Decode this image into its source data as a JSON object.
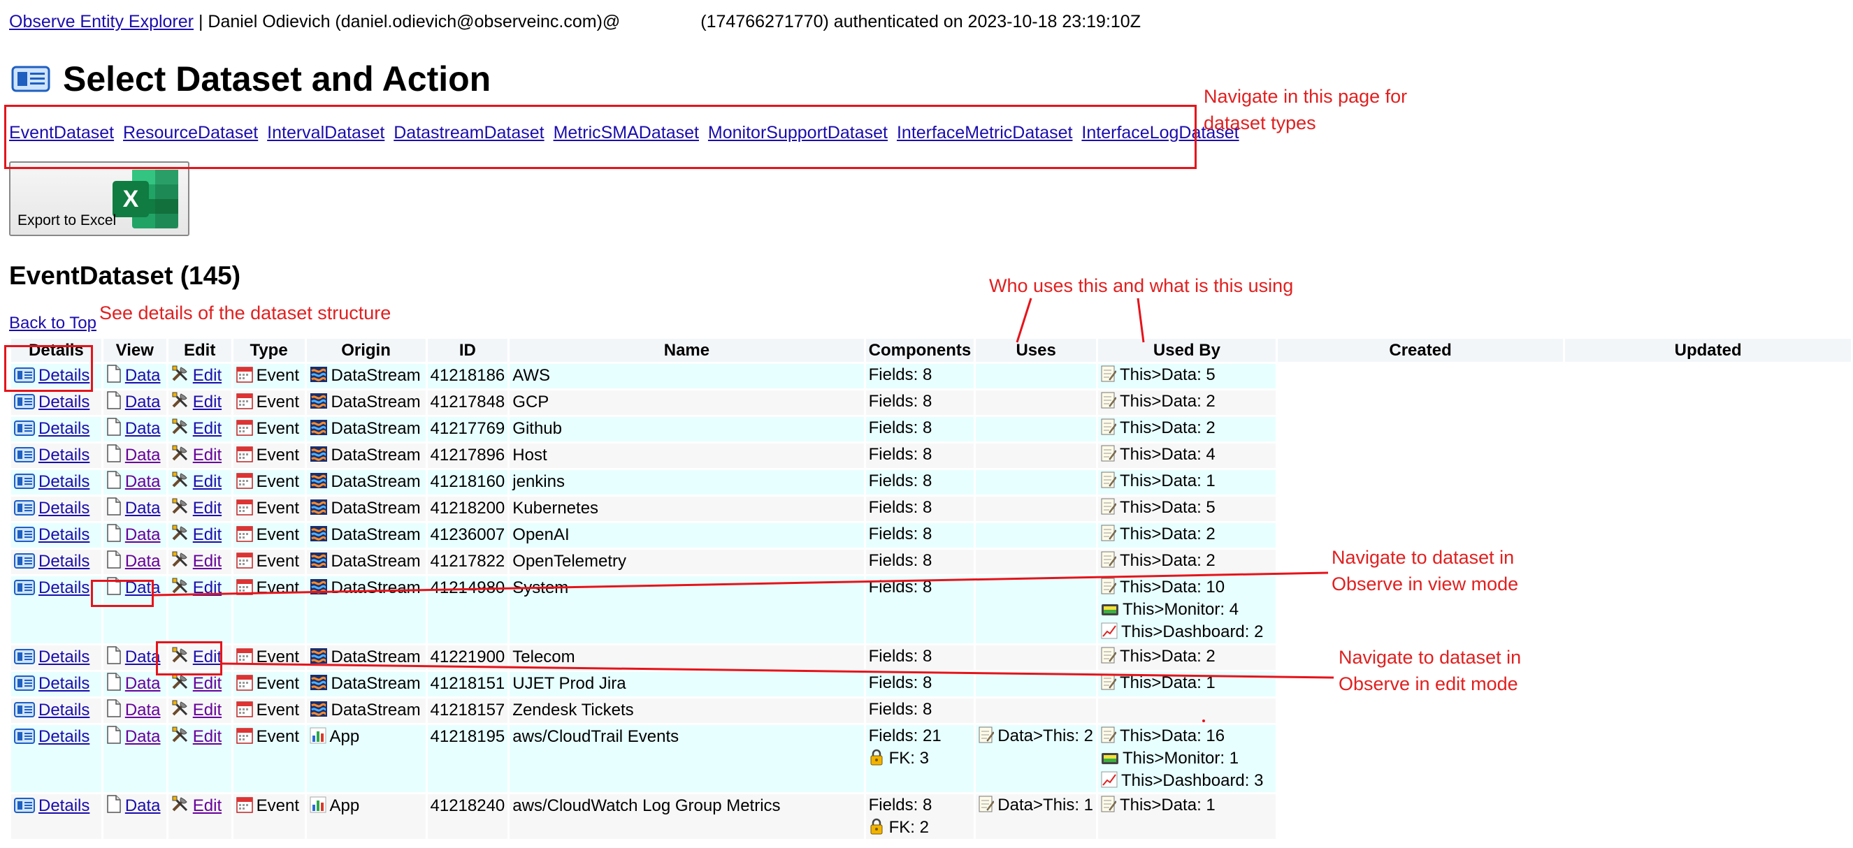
{
  "header": {
    "app_link": "Observe Entity Explorer",
    "user": " | Daniel Odievich (daniel.odievich@observeinc.com)@",
    "auth": "(174766271770) authenticated on 2023-10-18 23:19:10Z"
  },
  "page_title": "Select Dataset and Action",
  "type_links": [
    "EventDataset",
    "ResourceDataset",
    "IntervalDataset",
    "DatastreamDataset",
    "MetricSMADataset",
    "MonitorSupportDataset",
    "InterfaceMetricDataset",
    "InterfaceLogDataset"
  ],
  "export_label": "Export to Excel",
  "section_title": "EventDataset (145)",
  "back_to_top": "Back to Top",
  "annotations": {
    "nav_types": "Navigate in this page for\ndataset types",
    "details_hint": "See details of the dataset structure",
    "uses_hint": "Who uses this and what is this using",
    "view_mode": "Navigate to dataset in\nObserve in view mode",
    "edit_mode": "Navigate to dataset in\nObserve in edit mode"
  },
  "columns": [
    "Details",
    "View",
    "Edit",
    "Type",
    "Origin",
    "ID",
    "Name",
    "Components",
    "Uses",
    "Used By",
    "Created",
    "Updated"
  ],
  "link_labels": {
    "details": "Details",
    "view": "Data",
    "edit": "Edit"
  },
  "icons": {
    "details": "dataset-details-icon",
    "view": "document-icon",
    "edit": "tools-icon",
    "type": "event-calendar-icon",
    "origin_datastream": "datastream-icon",
    "origin_app": "bar-chart-icon",
    "data": "memo-icon",
    "monitor": "monitor-icon",
    "dashboard": "chart-line-icon",
    "fk": "lock-key-icon"
  },
  "colors": {
    "link": "#1a0dab",
    "visited": "#660099",
    "row_alt": "#e8ffff",
    "row": "#f7f7f7",
    "annotation": "#e02020",
    "excel": "#1d6f42"
  },
  "rows": [
    {
      "type": "Event",
      "origin": "DataStream",
      "id": "41218186",
      "name": "AWS",
      "components": [
        "Fields: 8"
      ],
      "uses": [],
      "used_by": [
        "This>Data: 5"
      ]
    },
    {
      "type": "Event",
      "origin": "DataStream",
      "id": "41217848",
      "name": "GCP",
      "components": [
        "Fields: 8"
      ],
      "uses": [],
      "used_by": [
        "This>Data: 2"
      ]
    },
    {
      "type": "Event",
      "origin": "DataStream",
      "id": "41217769",
      "name": "Github",
      "components": [
        "Fields: 8"
      ],
      "uses": [],
      "used_by": [
        "This>Data: 2"
      ]
    },
    {
      "type": "Event",
      "origin": "DataStream",
      "id": "41217896",
      "name": "Host",
      "components": [
        "Fields: 8"
      ],
      "uses": [],
      "used_by": [
        "This>Data: 4"
      ]
    },
    {
      "type": "Event",
      "origin": "DataStream",
      "id": "41218160",
      "name": "jenkins",
      "components": [
        "Fields: 8"
      ],
      "uses": [],
      "used_by": [
        "This>Data: 1"
      ]
    },
    {
      "type": "Event",
      "origin": "DataStream",
      "id": "41218200",
      "name": "Kubernetes",
      "components": [
        "Fields: 8"
      ],
      "uses": [],
      "used_by": [
        "This>Data: 5"
      ]
    },
    {
      "type": "Event",
      "origin": "DataStream",
      "id": "41236007",
      "name": "OpenAI",
      "components": [
        "Fields: 8"
      ],
      "uses": [],
      "used_by": [
        "This>Data: 2"
      ]
    },
    {
      "type": "Event",
      "origin": "DataStream",
      "id": "41217822",
      "name": "OpenTelemetry",
      "components": [
        "Fields: 8"
      ],
      "uses": [],
      "used_by": [
        "This>Data: 2"
      ]
    },
    {
      "type": "Event",
      "origin": "DataStream",
      "id": "41214980",
      "name": "System",
      "components": [
        "Fields: 8"
      ],
      "uses": [],
      "used_by": [
        "This>Data: 10",
        "This>Monitor: 4",
        "This>Dashboard: 2"
      ]
    },
    {
      "type": "Event",
      "origin": "DataStream",
      "id": "41221900",
      "name": "Telecom",
      "components": [
        "Fields: 8"
      ],
      "uses": [],
      "used_by": [
        "This>Data: 2"
      ]
    },
    {
      "type": "Event",
      "origin": "DataStream",
      "id": "41218151",
      "name": "UJET Prod Jira",
      "components": [
        "Fields: 8"
      ],
      "uses": [],
      "used_by": [
        "This>Data: 1"
      ]
    },
    {
      "type": "Event",
      "origin": "DataStream",
      "id": "41218157",
      "name": "Zendesk Tickets",
      "components": [
        "Fields: 8"
      ],
      "uses": [],
      "used_by": []
    },
    {
      "type": "Event",
      "origin": "App",
      "id": "41218195",
      "name": "aws/CloudTrail Events",
      "components": [
        "Fields: 21",
        "FK: 3"
      ],
      "uses": [
        "Data>This: 2"
      ],
      "used_by": [
        "This>Data: 16",
        "This>Monitor: 1",
        "This>Dashboard: 3"
      ]
    },
    {
      "type": "Event",
      "origin": "App",
      "id": "41218240",
      "name": "aws/CloudWatch Log Group Metrics",
      "components": [
        "Fields: 8",
        "FK: 2"
      ],
      "uses": [
        "Data>This: 1"
      ],
      "used_by": [
        "This>Data: 1"
      ]
    }
  ]
}
